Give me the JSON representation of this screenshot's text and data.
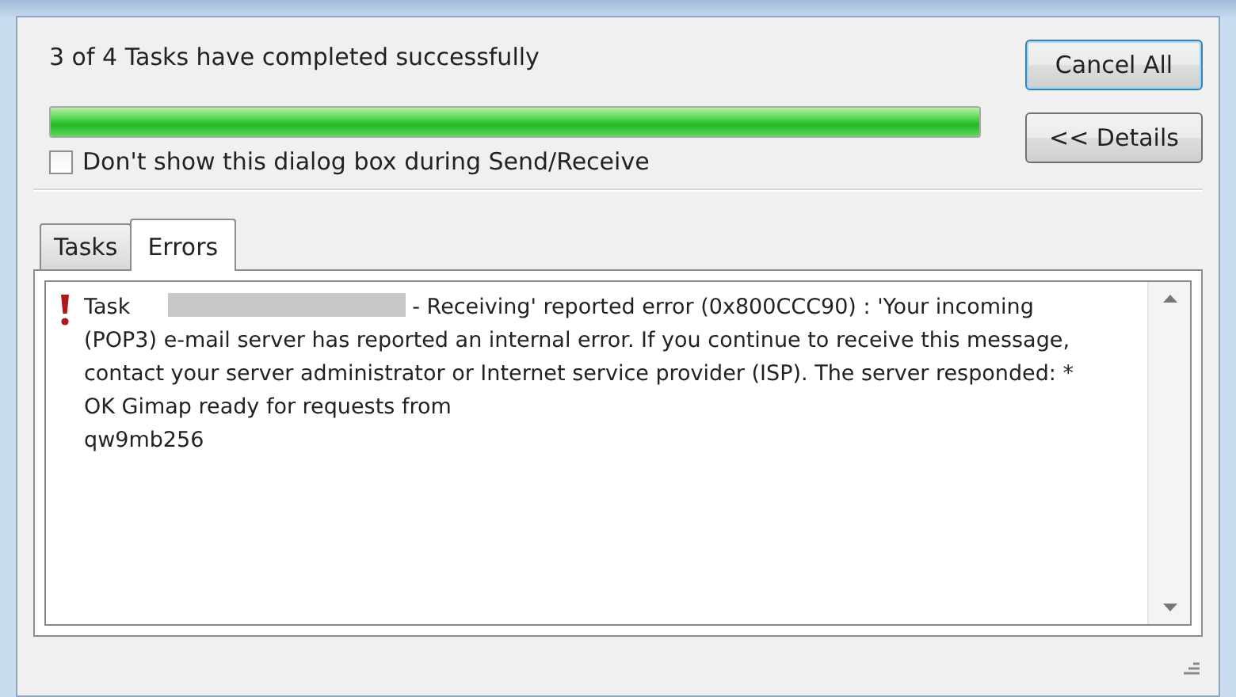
{
  "status": {
    "text": "3 of 4 Tasks have completed successfully"
  },
  "progress": {
    "level": 1.0
  },
  "dont_show": {
    "label": "Don't show this dialog box during Send/Receive",
    "checked": false
  },
  "buttons": [
    {
      "label": "Cancel All",
      "default": true
    },
    {
      "label": "<< Details",
      "default": false
    }
  ],
  "tabs": [
    {
      "label": "Tasks",
      "selected": false
    },
    {
      "label": "Errors",
      "selected": true
    }
  ],
  "errors": [
    {
      "kind": "error",
      "text_before": "Task",
      "redacted": true,
      "text_after": "- Receiving' reported error (0x800CCC90) : 'Your incoming (POP3) e-mail server has reported an internal error. If you continue to receive this message, contact your server administrator or Internet service provider (ISP).  The server responded: * OK Gimap ready for requests from\nqw9mb256"
    }
  ]
}
